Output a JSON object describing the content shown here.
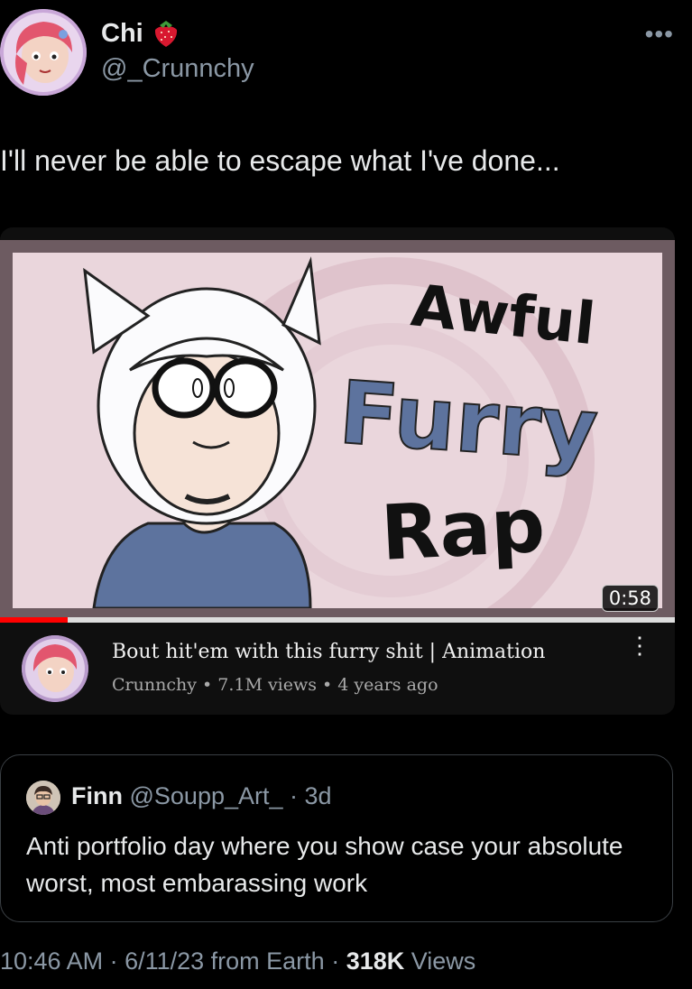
{
  "author": {
    "name": "Chi",
    "handle": "@_Crunnchy",
    "badge_icon": "strawberry-icon"
  },
  "tweet": {
    "text": "I'll never be able to escape what I've done..."
  },
  "menu": {
    "more_label": "•••"
  },
  "video": {
    "thumbnail_text": [
      "Awful",
      "Furry",
      "Rap"
    ],
    "duration": "0:58",
    "progress_fraction": 0.1,
    "title": "Bout hit'em with this furry shit | Animation",
    "subtitle": "Crunnchy • 7.1M views • 4 years ago",
    "menu_label": "⋮"
  },
  "quote": {
    "name": "Finn",
    "meta": "@Soupp_Art_ · 3d",
    "text": "Anti portfolio day where you show case your absolute worst, most embarassing work"
  },
  "footer": {
    "time_source": "10:46 AM · 6/11/23 from Earth · ",
    "views_count": "318K",
    "views_label": " Views"
  },
  "colors": {
    "background": "#000000",
    "text": "#e7e9ea",
    "muted": "#8b98a5",
    "progress": "#ff0000",
    "furry_blue": "#5d739e"
  }
}
